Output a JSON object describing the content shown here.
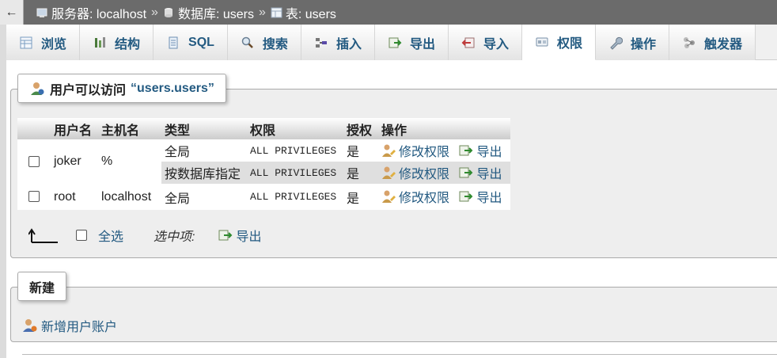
{
  "topbar": {
    "back_label": "←",
    "crumbs": [
      {
        "label": "服务器: localhost",
        "icon": "server-icon"
      },
      {
        "label": "数据库: users",
        "icon": "database-icon"
      },
      {
        "label": "表: users",
        "icon": "table-icon"
      }
    ],
    "separator": "»"
  },
  "tabs": [
    {
      "label": "浏览",
      "icon": "browse-icon"
    },
    {
      "label": "结构",
      "icon": "structure-icon"
    },
    {
      "label": "SQL",
      "icon": "sql-icon"
    },
    {
      "label": "搜索",
      "icon": "search-icon"
    },
    {
      "label": "插入",
      "icon": "insert-icon"
    },
    {
      "label": "导出",
      "icon": "export-icon"
    },
    {
      "label": "导入",
      "icon": "import-icon"
    },
    {
      "label": "权限",
      "icon": "privileges-icon",
      "active": true
    },
    {
      "label": "操作",
      "icon": "wrench-icon"
    },
    {
      "label": "触发器",
      "icon": "triggers-icon"
    }
  ],
  "access_panel": {
    "legend_prefix": "用户可以访问",
    "legend_quoted": "“users.users”",
    "columns": [
      "",
      "用户名",
      "主机名",
      "类型",
      "权限",
      "授权",
      "操作"
    ],
    "rows": [
      {
        "user": "joker",
        "host": "%",
        "entries": [
          {
            "type": "全局",
            "privileges": "ALL PRIVILEGES",
            "grant": "是",
            "edit": "修改权限",
            "export": "导出"
          },
          {
            "type": "按数据库指定",
            "privileges": "ALL PRIVILEGES",
            "grant": "是",
            "edit": "修改权限",
            "export": "导出"
          }
        ]
      },
      {
        "user": "root",
        "host": "localhost",
        "entries": [
          {
            "type": "全局",
            "privileges": "ALL PRIVILEGES",
            "grant": "是",
            "edit": "修改权限",
            "export": "导出"
          }
        ]
      }
    ],
    "footer": {
      "select_all": "全选",
      "with_selected": "选中项:",
      "export": "导出"
    }
  },
  "new_panel": {
    "legend": "新建",
    "add_user": "新增用户账户"
  },
  "colors": {
    "link": "#235a81",
    "topbar": "#6b6b6b",
    "panel_bg": "#eeeeee"
  }
}
